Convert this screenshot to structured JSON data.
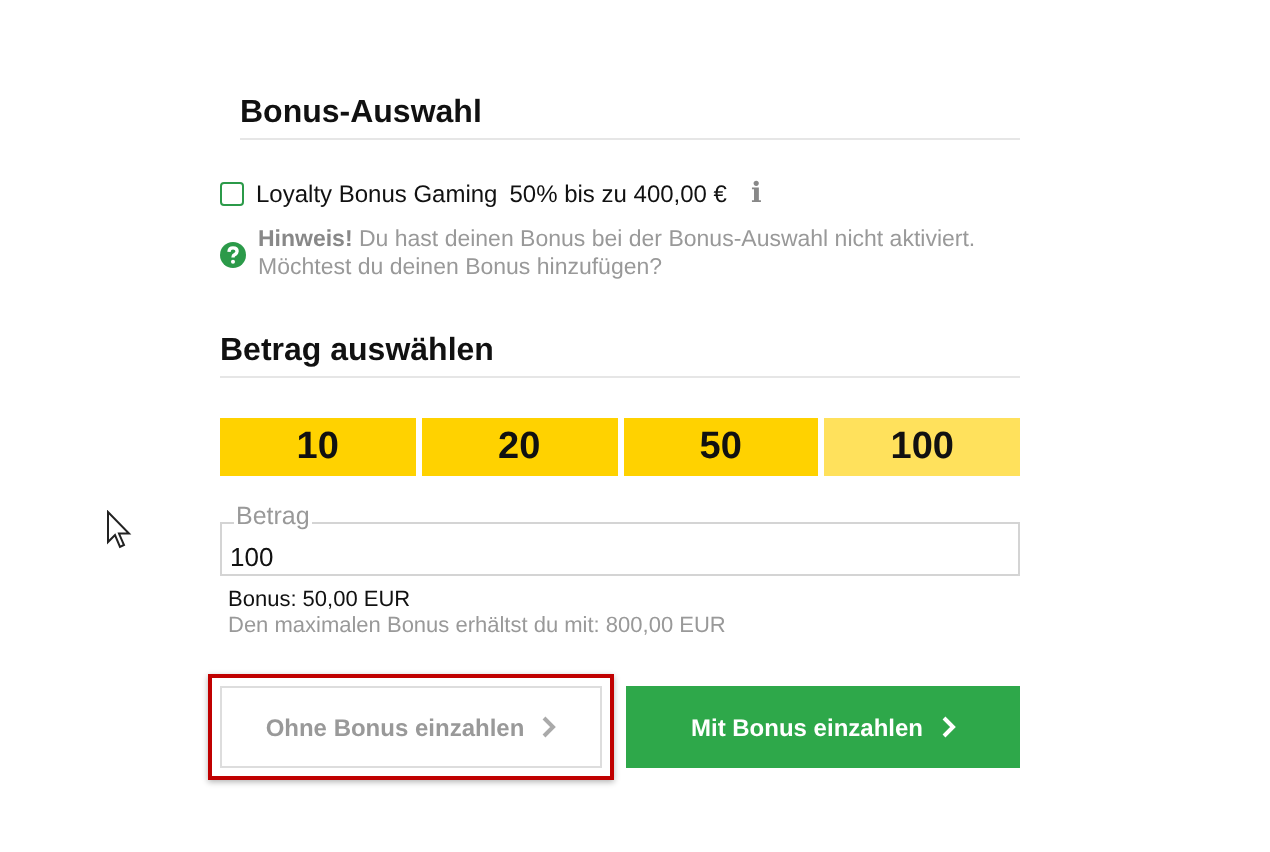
{
  "bonus_section": {
    "title": "Bonus-Auswahl",
    "option": {
      "label": "Loyalty Bonus Gaming",
      "detail": "50% bis zu 400,00 €",
      "checked": false,
      "info_icon": "i"
    },
    "hint": "**Hinweis!** Du hast deinen Bonus bei der Bonus-Auswahl nicht aktiviert. Möchtest du deinen Bonus hinzufügen?"
  },
  "amount_section": {
    "title": "Betrag auswählen",
    "presets": [
      {
        "label": "10",
        "selected": false
      },
      {
        "label": "20",
        "selected": false
      },
      {
        "label": "50",
        "selected": false
      },
      {
        "label": "100",
        "selected": true
      }
    ],
    "field": {
      "label": "Betrag",
      "value": "100"
    },
    "bonus_line": "Bonus: 50,00 EUR",
    "max_bonus_line": "Den maximalen Bonus erhältst du mit: 800,00 EUR"
  },
  "buttons": [
    {
      "kind": "secondary",
      "label": "Ohne Bonus einzahlen",
      "highlighted": true
    },
    {
      "kind": "primary",
      "label": "Mit Bonus einzahlen",
      "highlighted": false
    }
  ]
}
